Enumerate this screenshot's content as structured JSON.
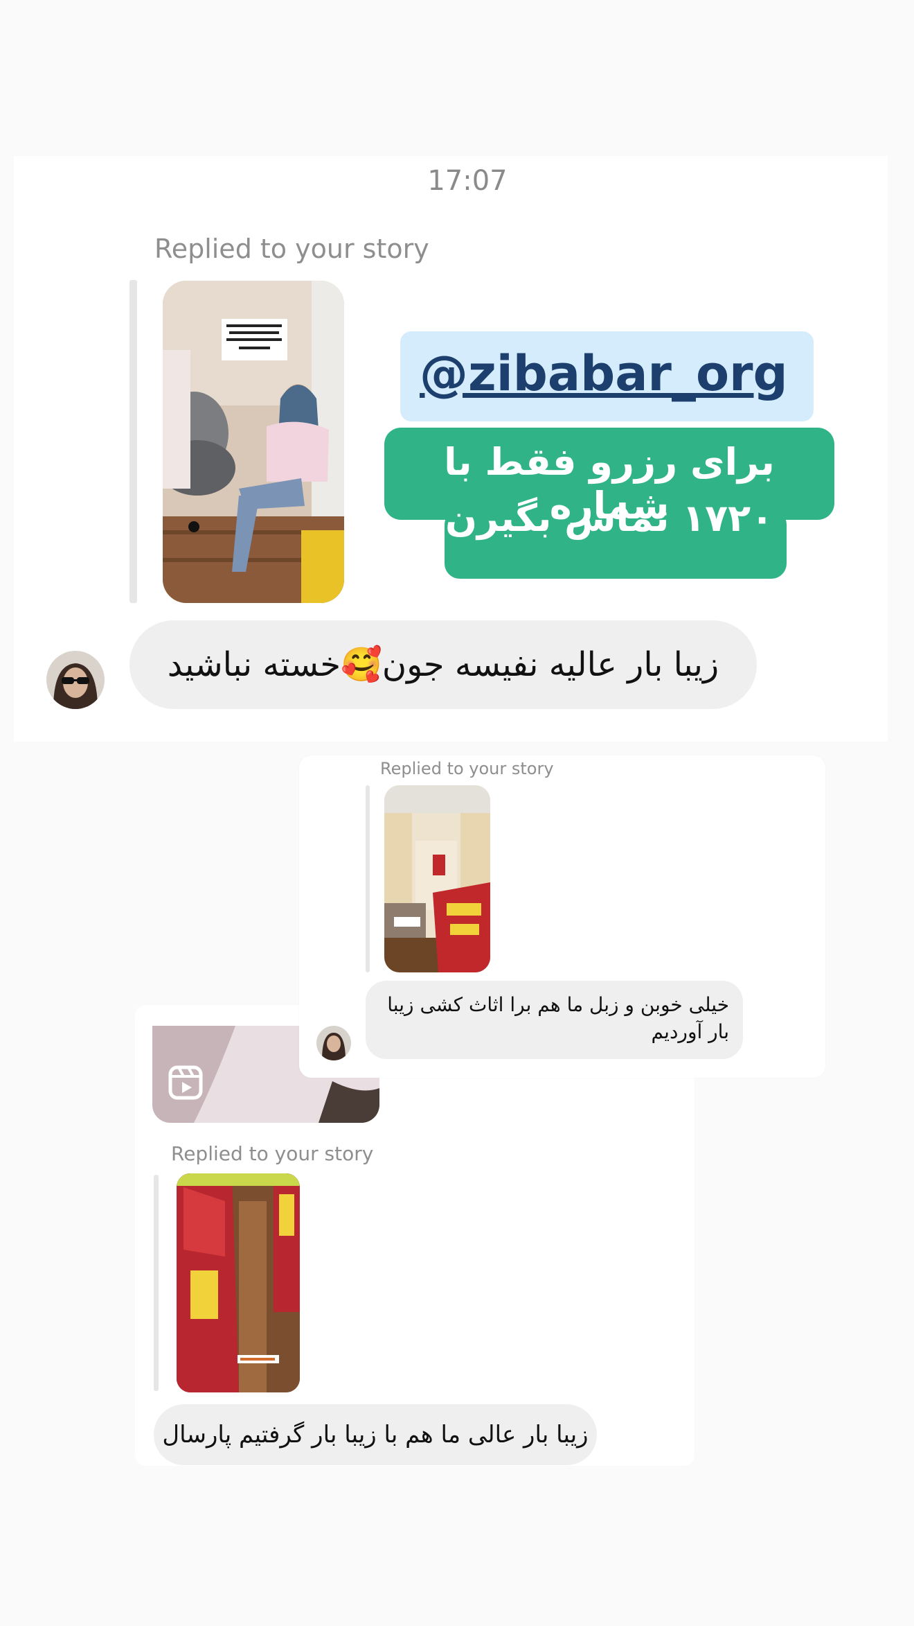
{
  "conversation": {
    "time": "17:07",
    "messages": [
      {
        "replied_label": "Replied to your story",
        "story_overlay": {
          "handle": "@zibabar_org",
          "promo_line1": "برای رزرو فقط با شماره",
          "promo_line2": "۱۷۲۰ تماس بگیرن"
        },
        "text": "زیبا بار عالیه نفیسه جون🥰خسته نباشید"
      },
      {
        "replied_label": "Replied to your story",
        "text_line1": "خیلی خوبن و زبل ما هم برا اثاث کشی زیبا",
        "text_line2": "بار آوردیم"
      },
      {
        "replied_label": "Replied to your story",
        "text": "زیبا بار عالی ما هم با زیبا بار گرفتیم پارسال"
      }
    ]
  },
  "icons": {
    "reel": "reel-icon"
  },
  "colors": {
    "promo_green": "#2fb387",
    "handle_bg": "#d4ecfb",
    "bubble_gray": "#efefef"
  }
}
